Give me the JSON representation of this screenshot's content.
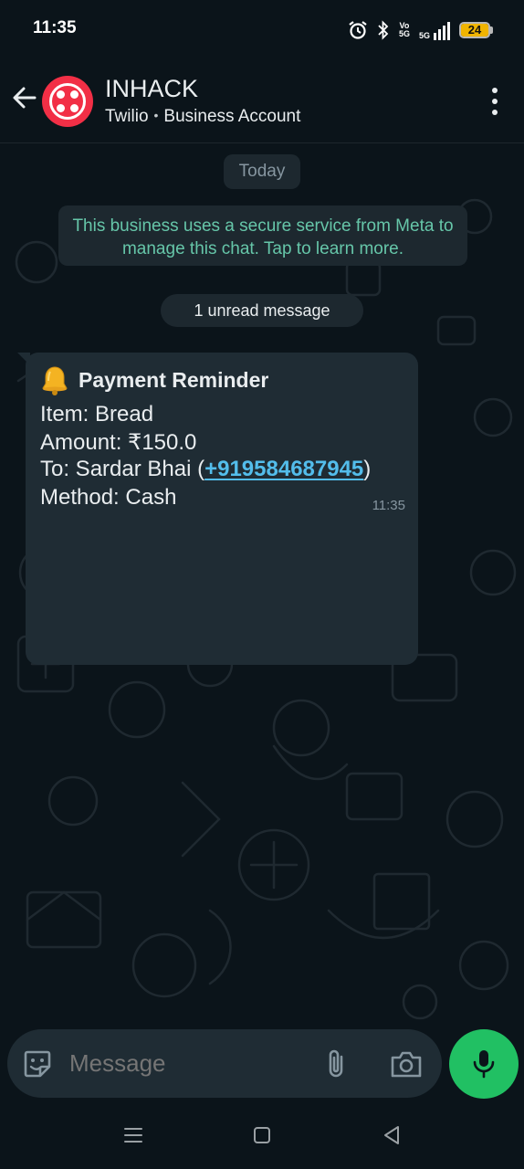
{
  "status_bar": {
    "time": "11:35",
    "volte_top": "Vo",
    "volte_bottom": "5G",
    "network": "5G",
    "battery_level": "24",
    "battery_color": "#f0b400"
  },
  "header": {
    "title": "INHACK",
    "subtitle_left": "Twilio",
    "subtitle_separator": "•",
    "subtitle_right": "Business Account",
    "avatar_color": "#f22f46"
  },
  "chat": {
    "date_label": "Today",
    "security_notice": "This business uses a secure service from Meta to manage this chat. Tap to learn more.",
    "unread_label": "1 unread message",
    "message": {
      "title": "Payment Reminder",
      "title_icon": "bell-icon",
      "item_line": "Item: Bread",
      "amount_line": "Amount: ₹150.0",
      "to_prefix": "To: Sardar Bhai (",
      "phone": "+919584687945",
      "to_suffix": ")",
      "method_line": "Method: Cash",
      "time": "11:35"
    }
  },
  "input_bar": {
    "placeholder": "Message",
    "mic_color": "#21c063"
  },
  "colors": {
    "background": "#0b141a",
    "bubble": "#1f2c34",
    "notice_text": "#66c6a9",
    "link": "#53bdeb"
  }
}
